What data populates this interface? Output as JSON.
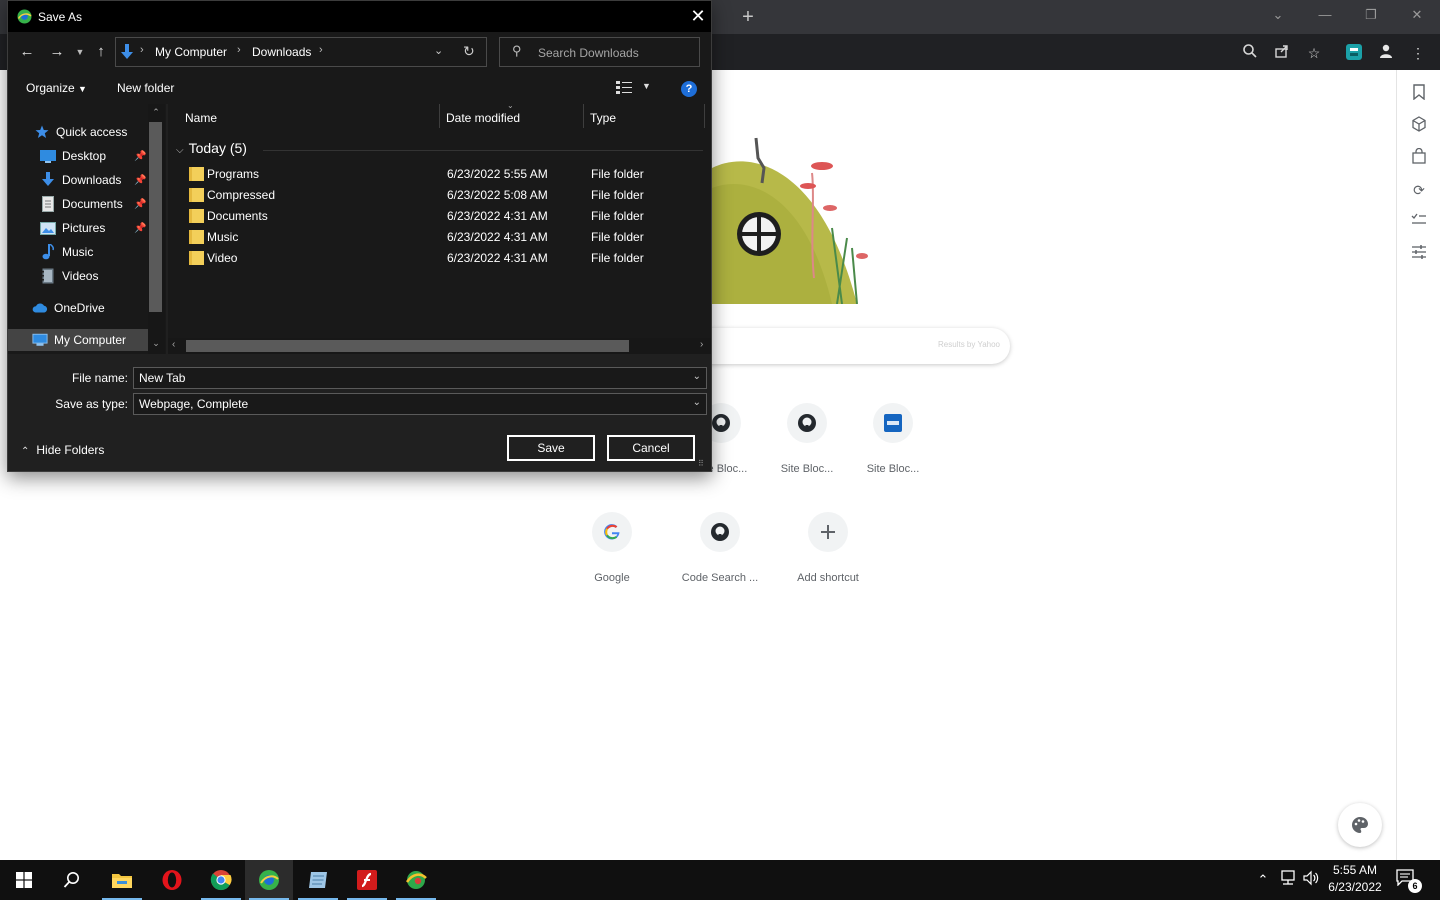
{
  "dialog": {
    "title": "Save As",
    "breadcrumb": [
      "My Computer",
      "Downloads"
    ],
    "search_placeholder": "Search Downloads",
    "commands": {
      "organize": "Organize",
      "new_folder": "New folder"
    },
    "nav_items": [
      {
        "label": "Quick access",
        "icon": "star-icon"
      },
      {
        "label": "Desktop",
        "icon": "desktop-icon",
        "pinned": true
      },
      {
        "label": "Downloads",
        "icon": "download-icon",
        "pinned": true
      },
      {
        "label": "Documents",
        "icon": "documents-icon",
        "pinned": true
      },
      {
        "label": "Pictures",
        "icon": "pictures-icon",
        "pinned": true
      },
      {
        "label": "Music",
        "icon": "music-icon"
      },
      {
        "label": "Videos",
        "icon": "videos-icon"
      },
      {
        "label": "OneDrive",
        "icon": "cloud-icon"
      },
      {
        "label": "My Computer",
        "icon": "computer-icon",
        "selected": true
      }
    ],
    "columns": [
      "Name",
      "Date modified",
      "Type"
    ],
    "group": "Today (5)",
    "files": [
      {
        "name": "Programs",
        "date": "6/23/2022 5:55 AM",
        "type": "File folder"
      },
      {
        "name": "Compressed",
        "date": "6/23/2022 5:08 AM",
        "type": "File folder"
      },
      {
        "name": "Documents",
        "date": "6/23/2022 4:31 AM",
        "type": "File folder"
      },
      {
        "name": "Music",
        "date": "6/23/2022 4:31 AM",
        "type": "File folder"
      },
      {
        "name": "Video",
        "date": "6/23/2022 4:31 AM",
        "type": "File folder"
      }
    ],
    "file_name_label": "File name:",
    "file_name_value": "New Tab",
    "save_type_label": "Save as type:",
    "save_type_value": "Webpage, Complete",
    "hide_folders": "Hide Folders",
    "save_button": "Save",
    "cancel_button": "Cancel"
  },
  "newtab": {
    "search_brand": "Results by Yahoo",
    "shortcuts_row1": [
      {
        "label": "Site Bloc...",
        "icon": "github-icon"
      },
      {
        "label": "Site Bloc...",
        "icon": "github-icon"
      },
      {
        "label": "Site Bloc...",
        "icon": "vmware-icon"
      }
    ],
    "shortcuts_row2": [
      {
        "label": "Google",
        "icon": "google-icon"
      },
      {
        "label": "Code Search ...",
        "icon": "github-icon"
      },
      {
        "label": "Add shortcut",
        "icon": "plus-icon"
      }
    ]
  },
  "taskbar": {
    "time": "5:55 AM",
    "date": "6/23/2022",
    "notification_count": "6"
  },
  "colors": {
    "dialog_bg": "#202020",
    "accent": "#1e6ed8",
    "folder": "#f3cf5a",
    "taskbar": "#101010"
  }
}
